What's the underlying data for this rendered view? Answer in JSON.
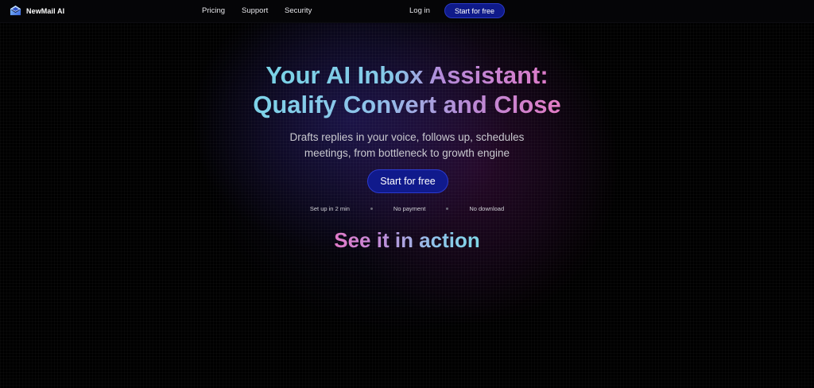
{
  "nav": {
    "brand": "NewMail AI",
    "links": [
      "Pricing",
      "Support",
      "Security"
    ],
    "login": "Log in",
    "cta": "Start for free"
  },
  "hero": {
    "title_line1": "Your AI Inbox Assistant:",
    "title_line2": "Qualify Convert and Close",
    "subtitle_line1": "Drafts replies in your voice, follows up, schedules",
    "subtitle_line2": "meetings, from bottleneck to growth engine",
    "cta": "Start for free",
    "features": [
      "Set up in 2 min",
      "No payment",
      "No download"
    ]
  },
  "section": {
    "title": "See it in action"
  },
  "colors": {
    "accent_button": "#101a8c",
    "gradient_cyan": "#7fd6e6",
    "gradient_pink": "#e07ac7",
    "background": "#000000"
  },
  "icons": {
    "logo": "mail-envelope-logo-icon"
  }
}
